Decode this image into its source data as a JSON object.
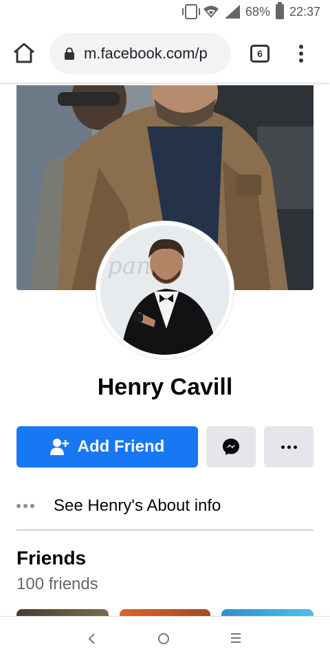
{
  "status_bar": {
    "battery_percent": "68%",
    "time": "22:37",
    "icons": [
      "vibrate-icon",
      "wifi-icon",
      "signal-icon",
      "battery-charging-icon"
    ]
  },
  "browser": {
    "url": "m.facebook.com/p",
    "tab_count": "6",
    "icons": [
      "home-icon",
      "lock-icon",
      "overflow-menu-icon"
    ]
  },
  "profile": {
    "name": "Henry Cavill",
    "add_friend_label": "Add Friend",
    "about_label": "See Henry's About info"
  },
  "friends": {
    "title": "Friends",
    "count_label": "100 friends"
  },
  "colors": {
    "primary": "#1877f2",
    "secondary_button": "#e4e6eb",
    "text": "#050505",
    "muted_text": "#65676b"
  }
}
